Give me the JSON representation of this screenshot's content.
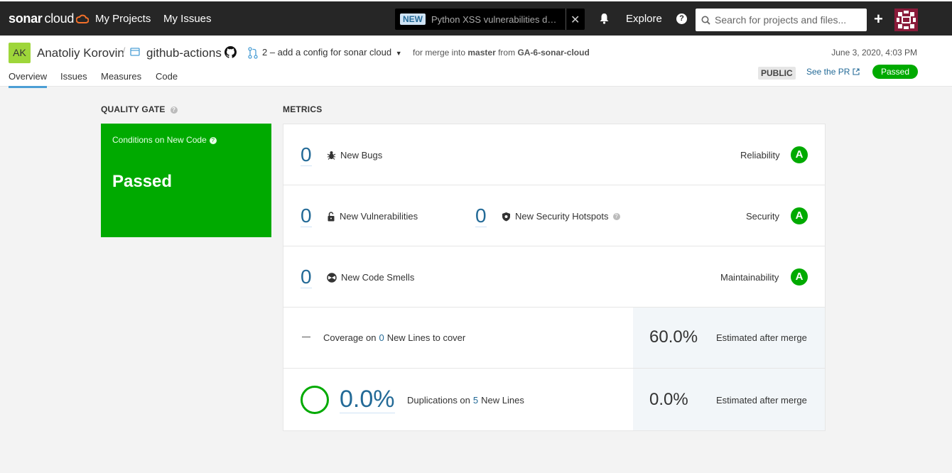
{
  "topnav": {
    "logo_bold": "sonar",
    "logo_light": "cloud",
    "my_projects": "My Projects",
    "my_issues": "My Issues",
    "announcement_badge": "NEW",
    "announcement_text": "Python XSS vulnerabilities dete…",
    "explore": "Explore",
    "help": "?",
    "search_placeholder": "Search for projects and files...",
    "plus": "+"
  },
  "project": {
    "org_initials": "AK",
    "org_name": "Anatoliy Korovin",
    "slash": "/",
    "repo": "github-actions",
    "pr_label": "2 – add a config for sonar cloud",
    "merge_prefix": "for merge into",
    "target_branch": "master",
    "merge_from": "from",
    "source_branch": "GA-6-sonar-cloud",
    "date": "June 3, 2020, 4:03 PM",
    "visibility": "PUBLIC",
    "see_pr": "See the PR",
    "status": "Passed"
  },
  "tabs": [
    "Overview",
    "Issues",
    "Measures",
    "Code"
  ],
  "quality_gate": {
    "title": "QUALITY GATE",
    "conditions": "Conditions on New Code",
    "status": "Passed"
  },
  "metrics": {
    "title": "METRICS",
    "bugs": {
      "value": "0",
      "label": "New Bugs",
      "rating_name": "Reliability",
      "rating": "A"
    },
    "vulnerabilities": {
      "value": "0",
      "label": "New Vulnerabilities"
    },
    "hotspots": {
      "value": "0",
      "label": "New Security Hotspots",
      "rating_name": "Security",
      "rating": "A"
    },
    "smells": {
      "value": "0",
      "label": "New Code Smells",
      "rating_name": "Maintainability",
      "rating": "A"
    },
    "coverage": {
      "prefix": "Coverage on",
      "lines": "0",
      "suffix": "New Lines to cover",
      "estimate": "60.0%",
      "estimate_label": "Estimated after merge"
    },
    "duplications": {
      "value": "0.0%",
      "prefix": "Duplications on",
      "lines": "5",
      "suffix": "New Lines",
      "estimate": "0.0%",
      "estimate_label": "Estimated after merge"
    }
  },
  "colors": {
    "passed_green": "#00aa00",
    "link_blue": "#236a97",
    "nav_bg": "#262626",
    "org_avatar": "#9ed63a"
  }
}
